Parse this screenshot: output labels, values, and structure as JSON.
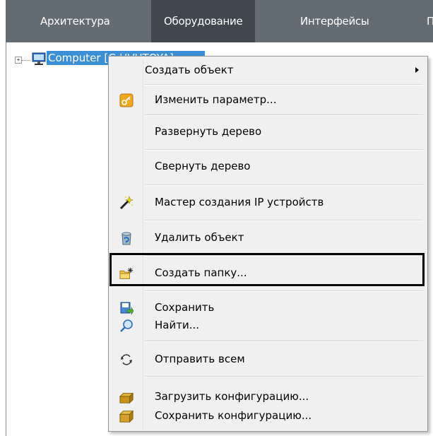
{
  "tabs": [
    {
      "label": "Архитектура",
      "active": false
    },
    {
      "label": "Оборудование",
      "active": true
    },
    {
      "label": "Интерфейсы",
      "active": false
    },
    {
      "label": "П",
      "active": false
    }
  ],
  "tree": {
    "expander": "+",
    "node_label": "Computer [C-HVUTOYA]",
    "node_icon": "computer-icon"
  },
  "menu": {
    "items": [
      {
        "label": "Создать объект",
        "icon": null,
        "submenu": true
      },
      {
        "label": "Изменить параметр...",
        "icon": "key-icon"
      },
      {
        "label": "Развернуть дерево",
        "icon": null
      },
      {
        "label": "Свернуть дерево",
        "icon": null
      },
      {
        "label": "Мастер создания IP устройств",
        "icon": "wand-icon"
      },
      {
        "label": "Удалить объект",
        "icon": "delete-bin-icon"
      },
      {
        "label": "Создать папку...",
        "icon": "new-folder-icon"
      },
      {
        "label": "Сохранить",
        "icon": "save-icon"
      },
      {
        "label": "Найти...",
        "icon": "search-icon"
      },
      {
        "label": "Отправить всем",
        "icon": "refresh-icon"
      },
      {
        "label": "Загрузить конфигурацию...",
        "icon": "load-config-icon"
      },
      {
        "label": "Сохранить конфигурацию...",
        "icon": "save-config-icon"
      }
    ],
    "highlighted_item": "Создать папку..."
  },
  "colors": {
    "tab_bar": "#646c73",
    "tab_active": "#40474e",
    "selection": "#3a8fd6",
    "menu_bg": "#f0f0f0"
  }
}
